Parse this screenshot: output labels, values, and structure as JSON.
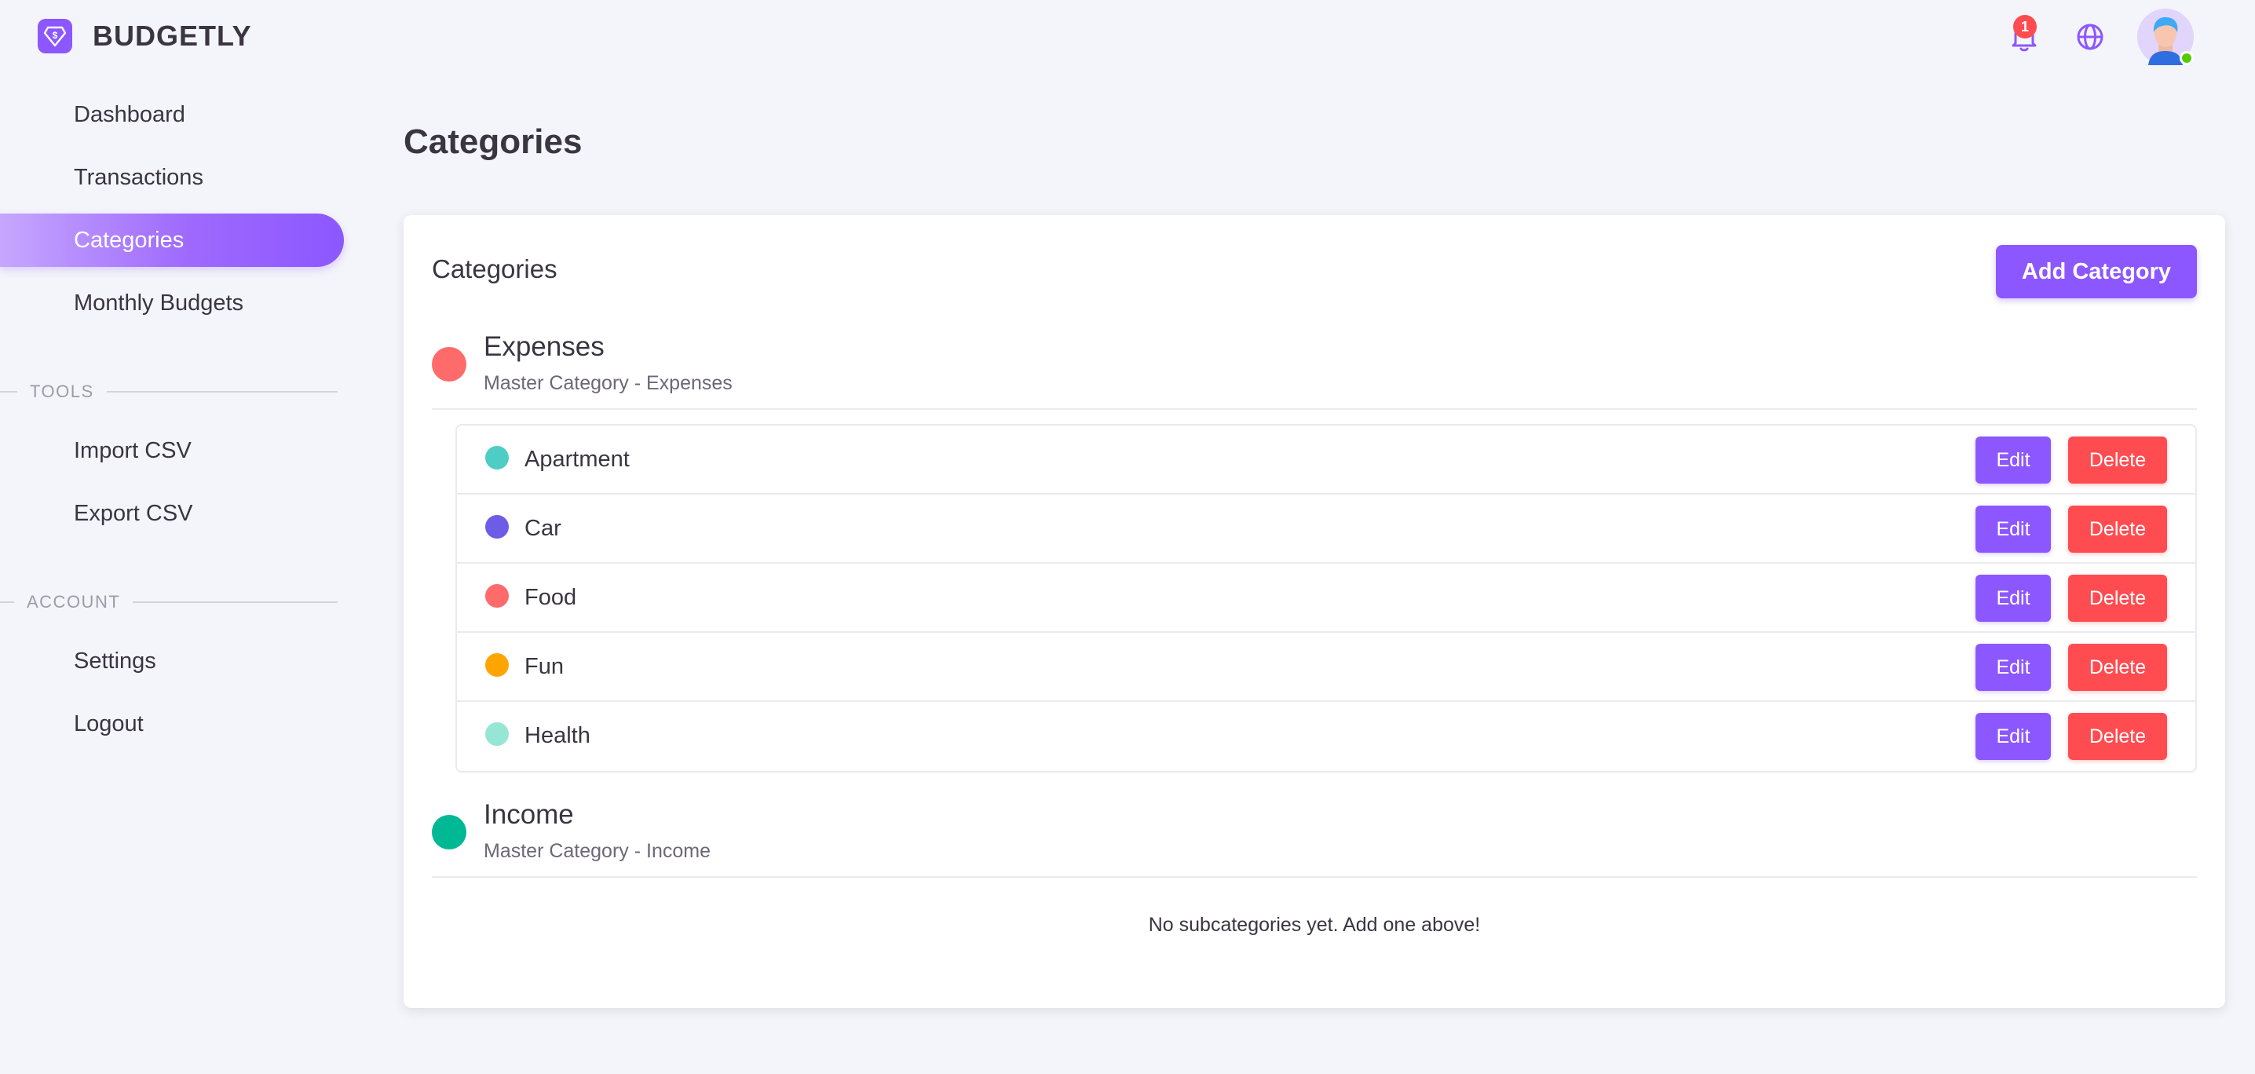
{
  "brand": {
    "name": "BUDGETLY",
    "logo_icon": "dollar-diamond-icon",
    "accent": "#8c57ff"
  },
  "sidebar": {
    "items": [
      {
        "label": "Dashboard"
      },
      {
        "label": "Transactions"
      },
      {
        "label": "Categories",
        "active": true
      },
      {
        "label": "Monthly Budgets"
      }
    ],
    "tools_heading": "TOOLS",
    "tools": [
      {
        "label": "Import CSV"
      },
      {
        "label": "Export CSV"
      }
    ],
    "account_heading": "ACCOUNT",
    "account": [
      {
        "label": "Settings"
      },
      {
        "label": "Logout"
      }
    ]
  },
  "topbar": {
    "notification_count": "1",
    "notification_icon": "bell-icon",
    "language_icon": "globe-icon",
    "avatar_status": "online"
  },
  "page": {
    "title": "Categories"
  },
  "card": {
    "title": "Categories",
    "add_button": "Add Category",
    "edit_label": "Edit",
    "delete_label": "Delete",
    "masters": [
      {
        "name": "Expenses",
        "subtitle": "Master Category - Expenses",
        "color": "#ff6b6b",
        "subcategories": [
          {
            "name": "Apartment",
            "color": "#4ecdc4"
          },
          {
            "name": "Car",
            "color": "#6c5ce7"
          },
          {
            "name": "Food",
            "color": "#ff6b6b"
          },
          {
            "name": "Fun",
            "color": "#ffa502"
          },
          {
            "name": "Health",
            "color": "#96e6d5"
          }
        ]
      },
      {
        "name": "Income",
        "subtitle": "Master Category - Income",
        "color": "#00b894",
        "empty_text": "No subcategories yet. Add one above!"
      }
    ]
  }
}
